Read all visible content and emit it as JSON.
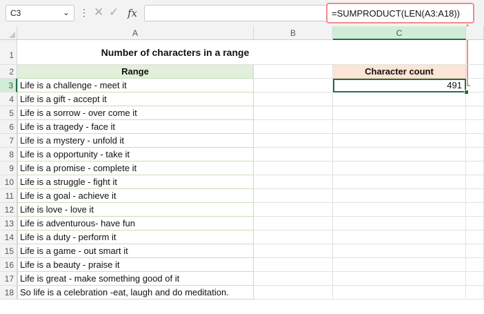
{
  "name_box": {
    "value": "C3"
  },
  "formula_bar": {
    "value": "=SUMPRODUCT(LEN(A3:A18))"
  },
  "columns": [
    "A",
    "B",
    "C"
  ],
  "rows": [
    "1",
    "2",
    "3",
    "4",
    "5",
    "6",
    "7",
    "8",
    "9",
    "10",
    "11",
    "12",
    "13",
    "14",
    "15",
    "16",
    "17",
    "18"
  ],
  "sheet": {
    "title": "Number of characters in a range",
    "range_header": "Range",
    "count_header": "Character count",
    "count_value": "491",
    "range_values": [
      "Life is a challenge - meet it",
      "Life is a gift - accept it",
      "Life is a sorrow - over come it",
      "Life is a tragedy - face it",
      "Life is a mystery - unfold it",
      "Life is a opportunity - take it",
      "Life is a promise - complete it",
      "Life is a struggle - fight it",
      "Life is a goal - achieve it",
      "Life is love - love it",
      "Life is adventurous- have fun",
      "Life is a duty - perform it",
      "Life is a game - out smart it",
      "Life is a beauty - praise it",
      "Life is great - make something good of it",
      "So life is a celebration -eat, laugh and do meditation."
    ]
  },
  "colors": {
    "accent": "#1e7145",
    "header_green": "#e2efda",
    "header_orange": "#fce4d6",
    "highlight": "#f48a8a"
  }
}
